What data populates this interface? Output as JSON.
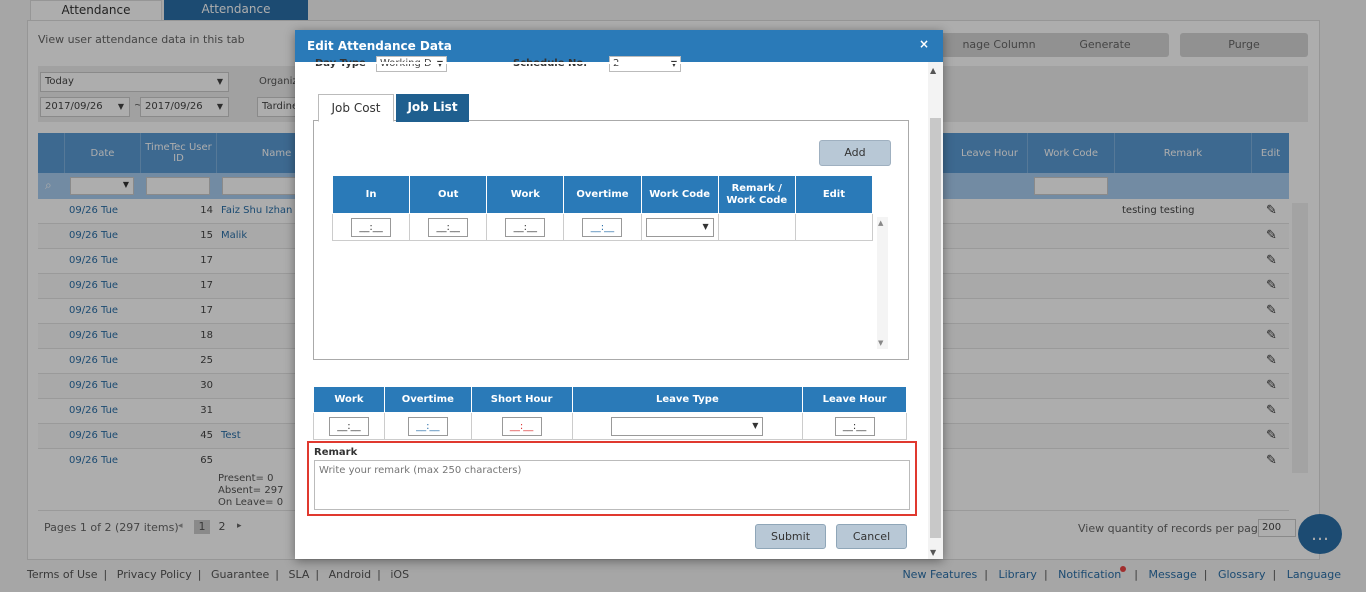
{
  "tabs": [
    "Attendance Sheet",
    "Attendance Analysis"
  ],
  "subtitle": "View user attendance data in this tab",
  "top_buttons": [
    "nage Column",
    "Generate",
    "Purge"
  ],
  "filters": {
    "period": "Today",
    "from": "2017/09/26",
    "to": "2017/09/26",
    "range_sep": "~",
    "org_label": "Organiz",
    "tard_label": "Tardine"
  },
  "grid": {
    "headers": [
      "Date",
      "TimeTec User ID",
      "Name",
      "Leave Hour",
      "Work Code",
      "Remark",
      "Edit"
    ],
    "rows": [
      {
        "date": "09/26 Tue",
        "uid": "14",
        "name": "Faiz Shu Izhan",
        "remark": "testing testing"
      },
      {
        "date": "09/26 Tue",
        "uid": "15",
        "name": "Malik",
        "remark": ""
      },
      {
        "date": "09/26 Tue",
        "uid": "17",
        "name": "",
        "remark": ""
      },
      {
        "date": "09/26 Tue",
        "uid": "17",
        "name": "",
        "remark": ""
      },
      {
        "date": "09/26 Tue",
        "uid": "17",
        "name": "",
        "remark": ""
      },
      {
        "date": "09/26 Tue",
        "uid": "18",
        "name": "",
        "remark": ""
      },
      {
        "date": "09/26 Tue",
        "uid": "25",
        "name": "",
        "remark": ""
      },
      {
        "date": "09/26 Tue",
        "uid": "30",
        "name": "",
        "remark": ""
      },
      {
        "date": "09/26 Tue",
        "uid": "31",
        "name": "",
        "remark": ""
      },
      {
        "date": "09/26 Tue",
        "uid": "45",
        "name": "Test",
        "remark": ""
      },
      {
        "date": "09/26 Tue",
        "uid": "65",
        "name": "",
        "remark": ""
      }
    ],
    "summary": [
      "Present= 0",
      "Absent= 297",
      "On Leave= 0"
    ]
  },
  "pager": {
    "text": "Pages 1 of 2 (297 items)",
    "pages": [
      "1",
      "2"
    ],
    "qty_label": "View quantity of records per page",
    "qty_value": "200"
  },
  "footer": {
    "left": [
      "Terms of Use",
      "Privacy Policy",
      "Guarantee",
      "SLA",
      "Android",
      "iOS"
    ],
    "right": [
      "New Features",
      "Library",
      "Notification",
      "Message",
      "Glossary",
      "Language"
    ]
  },
  "modal": {
    "title": "Edit Attendance Data",
    "close": "×",
    "day_type_label": "Day Type",
    "day_type_value": "Working D",
    "schedule_label": "Schedule No.",
    "schedule_value": "2",
    "job_tabs": [
      "Job Cost",
      "Job List"
    ],
    "add_label": "Add",
    "job_headers": [
      "In",
      "Out",
      "Work",
      "Overtime",
      "Work Code",
      "Remark / Work Code",
      "Edit"
    ],
    "job_row": {
      "in": "__:__",
      "out": "__:__",
      "work": "__:__",
      "overtime": "__:__"
    },
    "summary_headers": [
      "Work",
      "Overtime",
      "Short Hour",
      "Leave Type",
      "Leave Hour"
    ],
    "summary_row": {
      "work": "__:__",
      "overtime": "__:__",
      "short": "__:__",
      "leave_hour": "__:__"
    },
    "remark_label": "Remark",
    "remark_placeholder": "Write your remark (max 250 characters)",
    "submit": "Submit",
    "cancel": "Cancel"
  },
  "colors": {
    "accent": "#2a7ab8",
    "highlight": "#e0392f"
  }
}
